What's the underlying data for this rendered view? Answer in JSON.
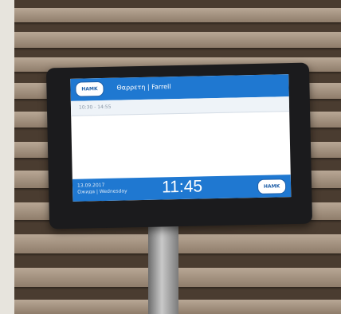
{
  "screen": {
    "logo_text": "HAMK",
    "room_title": "Θαρρετη | Farrell",
    "slot_time": "10:30 - 14:55",
    "date_line": "13.09.2017",
    "day_line": "Ожида | Wednesday",
    "clock": "11:45",
    "logo_text_right": "HAMK"
  },
  "colors": {
    "bar": "#1f78d1",
    "screen_bg": "#ffffff"
  }
}
